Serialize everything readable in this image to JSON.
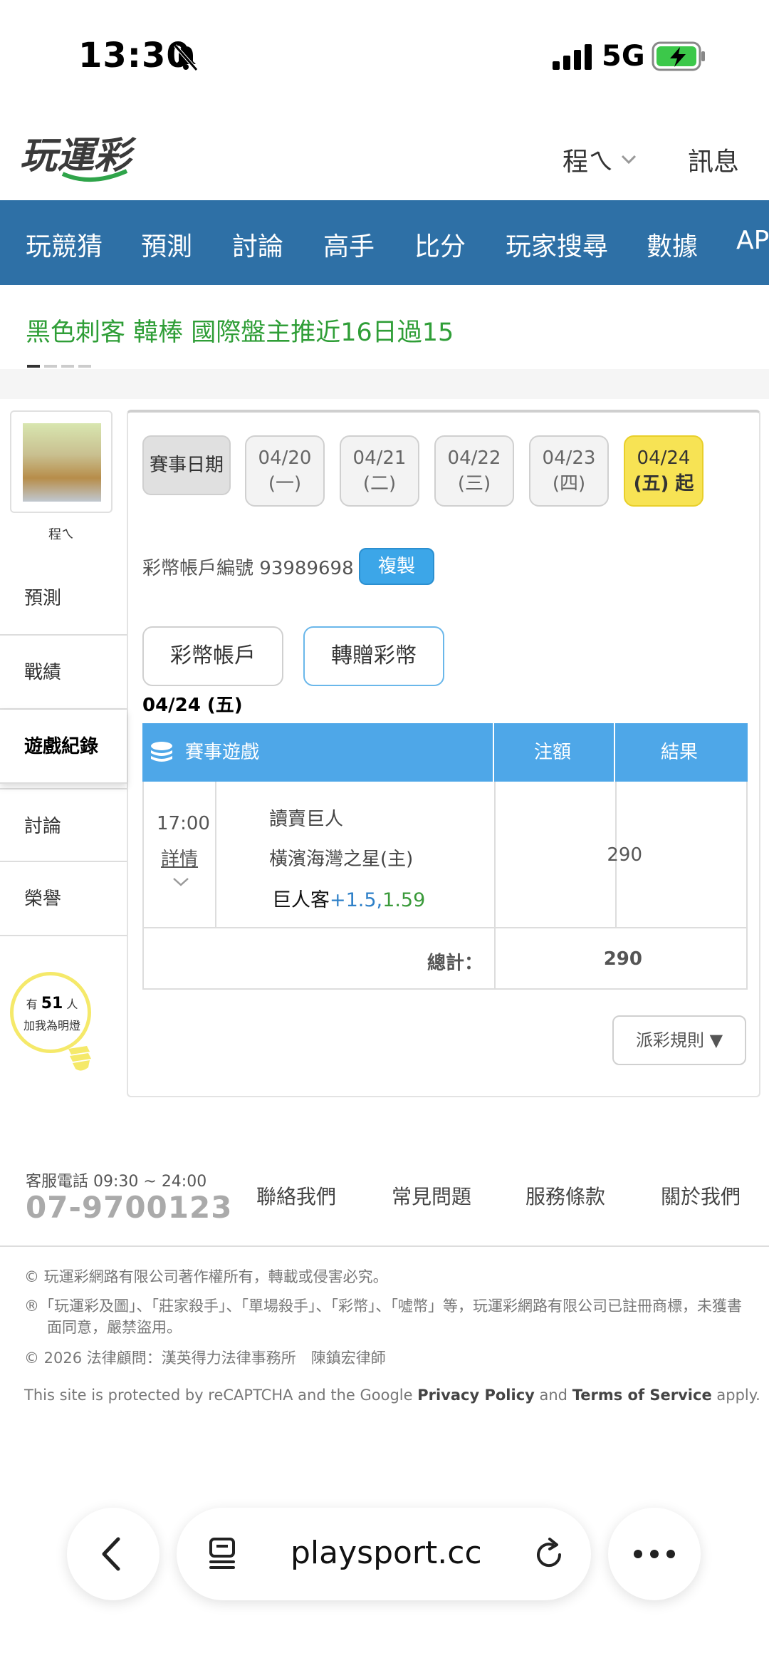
{
  "status_bar": {
    "time": "13:30",
    "network": "5G"
  },
  "header": {
    "user_name": "程ㄟ",
    "messages": "訊息"
  },
  "nav": {
    "items": [
      "玩競猜",
      "預測",
      "討論",
      "高手",
      "比分",
      "玩家搜尋",
      "數據",
      "APP"
    ]
  },
  "marquee": {
    "text": "黑色刺客 韓棒 國際盤主推近16日過15"
  },
  "sidebar": {
    "avatar_name": "程ㄟ",
    "items": [
      "預測",
      "戰績",
      "遊戲紀錄",
      "討論",
      "榮譽"
    ],
    "active": "遊戲紀錄",
    "bulb": {
      "prefix": "有",
      "count": "51",
      "suffix": "人",
      "caption": "加我為明燈"
    }
  },
  "dates": {
    "label": "賽事日期",
    "days": [
      {
        "date": "04/20",
        "weekday": "(一)"
      },
      {
        "date": "04/21",
        "weekday": "(二)"
      },
      {
        "date": "04/22",
        "weekday": "(三)"
      },
      {
        "date": "04/23",
        "weekday": "(四)"
      },
      {
        "date": "04/24",
        "weekday": "(五)",
        "suffix": "起"
      }
    ]
  },
  "account": {
    "label": "彩幣帳戶編號",
    "number": "93989698",
    "copy_label": "複製"
  },
  "tabs": {
    "coin_account": "彩幣帳戶",
    "transfer": "轉贈彩幣"
  },
  "day_title": "04/24 (五)",
  "table": {
    "headers": {
      "game": "賽事遊戲",
      "amount": "注額",
      "result": "結果"
    },
    "rows": [
      {
        "time": "17:00",
        "detail": "詳情",
        "away": "讀賣巨人",
        "home": "橫濱海灣之星(主)",
        "pick_team": "巨人客",
        "pick_handicap": "+1.5,",
        "pick_odds": "1.59",
        "amount": "290",
        "result": ""
      }
    ],
    "total_label": "總計：",
    "total_value": "290"
  },
  "rules_button": "派彩規則 ▼",
  "footer": {
    "hotline_label": "客服電話 09:30 ~ 24:00",
    "hotline_number": "07-9700123",
    "links": [
      "聯絡我們",
      "常見問題",
      "服務條款",
      "關於我們"
    ],
    "copyright1": "© 玩運彩網路有限公司著作權所有，轉載或侵害必究。",
    "copyright2": "®「玩運彩及圖」、「莊家殺手」、「單場殺手」、「彩幣」、「噓幣」等，玩運彩網路有限公司已註冊商標，未獲書面同意，嚴禁盜用。",
    "copyright3": "© 2026 法律顧問：漢英得力法律事務所　陳鎮宏律師",
    "recaptcha_pre": "This site is protected by reCAPTCHA and the Google ",
    "privacy": "Privacy Policy",
    "recaptcha_mid": " and ",
    "terms": "Terms of Service",
    "recaptcha_post": " apply."
  },
  "browser": {
    "url": "playsport.cc"
  },
  "colors": {
    "nav_bg": "#2e70a6",
    "marquee_green": "#2f9e37",
    "table_header": "#4ea7e8",
    "active_date": "#f7e354",
    "copy_button": "#3ca6e8"
  }
}
